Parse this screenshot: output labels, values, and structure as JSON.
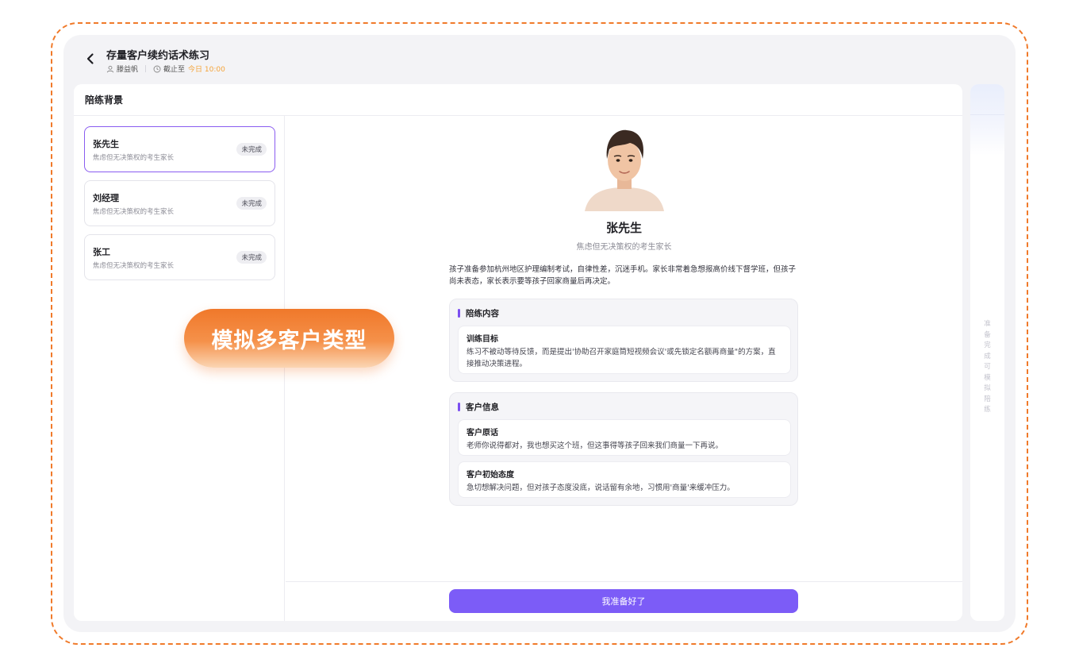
{
  "header": {
    "title": "存量客户续约话术练习",
    "user_name": "滕益帆",
    "deadline_label": "截止至",
    "deadline_value": "今日 10:00"
  },
  "panel": {
    "title": "陪练背景"
  },
  "customers": [
    {
      "name": "张先生",
      "desc": "焦虑但无决策权的考生家长",
      "status": "未完成"
    },
    {
      "name": "刘经理",
      "desc": "焦虑但无决策权的考生家长",
      "status": "未完成"
    },
    {
      "name": "张工",
      "desc": "焦虑但无决策权的考生家长",
      "status": "未完成"
    }
  ],
  "promo": {
    "text": "模拟多客户类型"
  },
  "detail": {
    "name": "张先生",
    "role": "焦虑但无决策权的考生家长",
    "background": "孩子准备参加杭州地区护理编制考试，自律性差，沉迷手机。家长非常着急想报高价线下督学班，但孩子尚未表态，家长表示要等孩子回家商量后再决定。",
    "training": {
      "title": "陪练内容",
      "goal_title": "训练目标",
      "goal_text": "练习不被动等待反馈，而是提出'协助召开家庭筒短视频会议'或先锁定名额再商量\"的方案，直接推动决策进程。"
    },
    "customer_info": {
      "title": "客户信息",
      "quote_title": "客户原话",
      "quote_text": "老师你说得都对，我也想买这个班，但这事得等孩子回来我们商量一下再说。",
      "attitude_title": "客户初始态度",
      "attitude_text": "急切想解决问题，但对孩子态度没底，说话留有余地，习惯用'商量'来缓冲压力。"
    }
  },
  "footer": {
    "ready_label": "我准备好了"
  },
  "side": {
    "hint": "准备完成可模拟陪练"
  },
  "colors": {
    "accent": "#7c5cf7",
    "promo": "#f0782a",
    "deadline": "#f4a43a"
  }
}
